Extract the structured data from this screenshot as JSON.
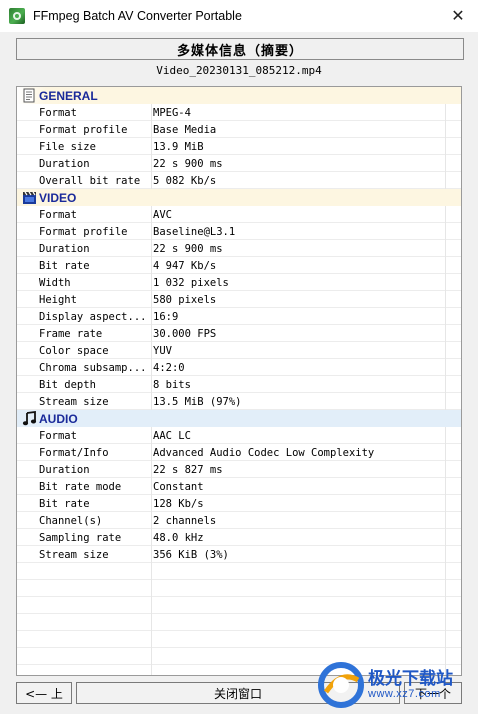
{
  "window": {
    "title": "FFmpeg Batch AV Converter Portable",
    "close_glyph": "✕"
  },
  "header": {
    "title": "多媒体信息（摘要）"
  },
  "file_name": "Video_20230131_085212.mp4",
  "sections": {
    "general": {
      "title": "GENERAL",
      "icon": "file-info-icon",
      "rows": [
        {
          "key": "Format",
          "value": "MPEG-4"
        },
        {
          "key": "Format profile",
          "value": "Base Media"
        },
        {
          "key": "File size",
          "value": "13.9 MiB"
        },
        {
          "key": "Duration",
          "value": "22 s 900 ms"
        },
        {
          "key": "Overall bit rate",
          "value": "5 082 Kb/s"
        }
      ]
    },
    "video": {
      "title": "VIDEO",
      "icon": "film-clapper-icon",
      "rows": [
        {
          "key": "Format",
          "value": "AVC"
        },
        {
          "key": "Format profile",
          "value": "Baseline@L3.1"
        },
        {
          "key": "Duration",
          "value": "22 s 900 ms"
        },
        {
          "key": "Bit rate",
          "value": "4 947 Kb/s"
        },
        {
          "key": "Width",
          "value": "1 032 pixels"
        },
        {
          "key": "Height",
          "value": "580 pixels"
        },
        {
          "key": "Display aspect...",
          "value": "16:9"
        },
        {
          "key": "Frame rate",
          "value": "30.000 FPS"
        },
        {
          "key": "Color space",
          "value": "YUV"
        },
        {
          "key": "Chroma subsamp...",
          "value": "4:2:0"
        },
        {
          "key": "Bit depth",
          "value": "8 bits"
        },
        {
          "key": "Stream size",
          "value": "13.5 MiB (97%)"
        }
      ]
    },
    "audio": {
      "title": "AUDIO",
      "icon": "music-note-icon",
      "rows": [
        {
          "key": "Format",
          "value": "AAC LC"
        },
        {
          "key": "Format/Info",
          "value": "Advanced Audio Codec Low Complexity"
        },
        {
          "key": "Duration",
          "value": "22 s 827 ms"
        },
        {
          "key": "Bit rate mode",
          "value": "Constant"
        },
        {
          "key": "Bit rate",
          "value": "128 Kb/s"
        },
        {
          "key": "Channel(s)",
          "value": "2 channels"
        },
        {
          "key": "Sampling rate",
          "value": "48.0 kHz"
        },
        {
          "key": "Stream size",
          "value": "356 KiB (3%)"
        }
      ]
    }
  },
  "buttons": {
    "prev": "<— 上",
    "close": "关闭窗口",
    "next": "下一个"
  },
  "watermark": {
    "brand": "极光下载站",
    "url": "www.xz7.com"
  },
  "colors": {
    "section_text": "#1a2a9a",
    "general_bg": "#fdf6e1",
    "video_bg": "#fdf6e1",
    "audio_bg": "#e2eef9",
    "watermark": "#1f57c5"
  }
}
